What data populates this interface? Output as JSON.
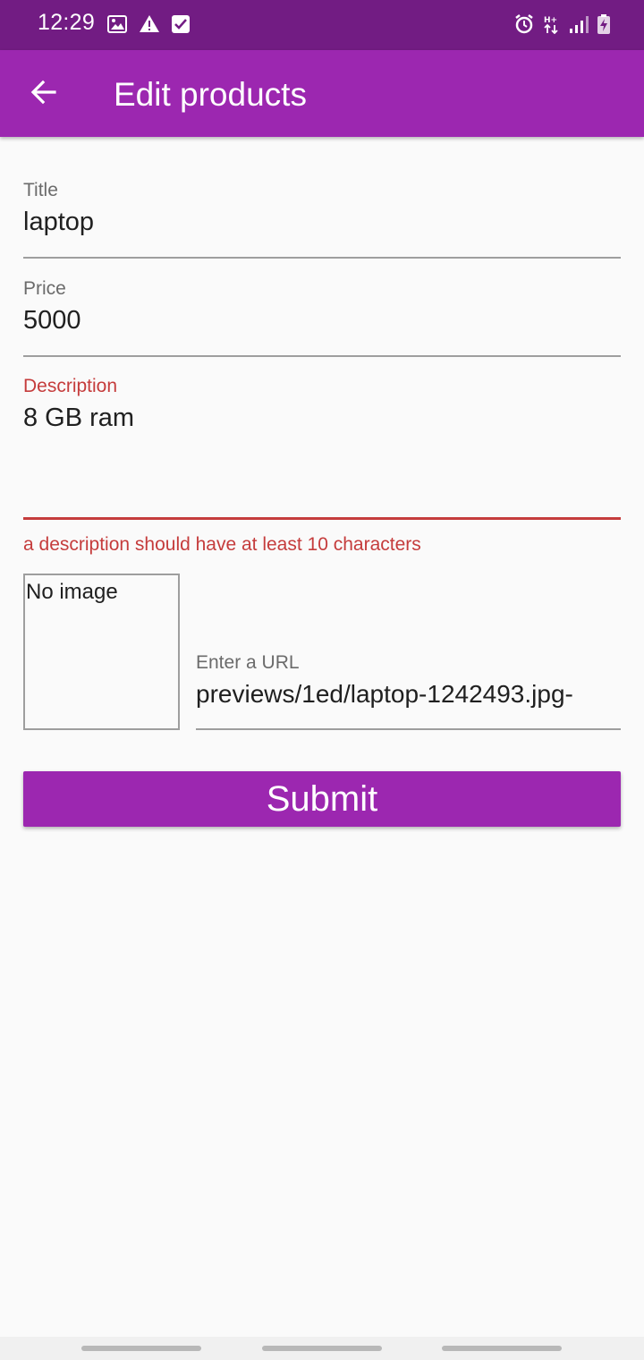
{
  "status_bar": {
    "time": "12:29",
    "left_icons": [
      "image-icon",
      "warning-icon",
      "checkbox-icon"
    ],
    "right_icons": [
      "alarm-icon",
      "network-type-icon",
      "signal-icon",
      "battery-charging-icon"
    ]
  },
  "app_bar": {
    "title": "Edit products",
    "back_icon": "arrow-back-icon",
    "color": "#9c27b0"
  },
  "form": {
    "title": {
      "label": "Title",
      "value": "laptop"
    },
    "price": {
      "label": "Price",
      "value": "5000"
    },
    "description": {
      "label": "Description",
      "value": "8 GB ram",
      "error": "a description should have at least 10 characters",
      "error_color": "#c53c3c"
    },
    "image_preview": {
      "text": "No image"
    },
    "url": {
      "label": "Enter a URL",
      "value": "-previews/1ed/laptop-1242493.jpg"
    },
    "submit_label": "Submit"
  },
  "colors": {
    "primary": "#9c27b0",
    "status_bar": "#721c83",
    "error": "#c53c3c"
  }
}
